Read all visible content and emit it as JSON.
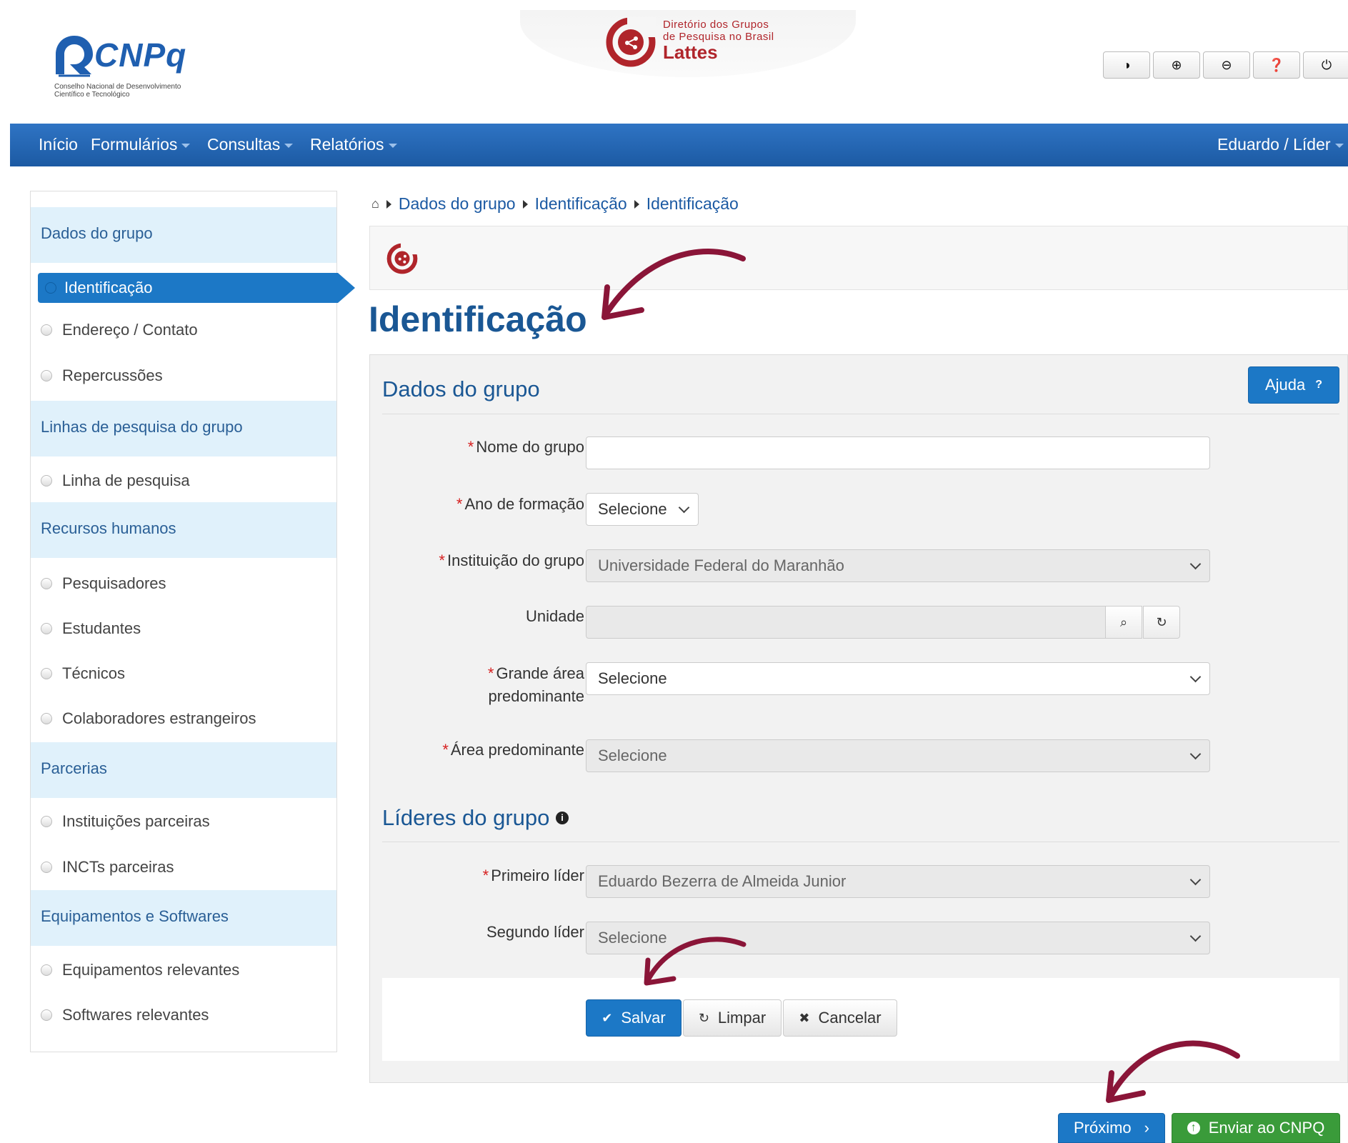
{
  "header": {
    "cnpq_logo_text": "CNPq",
    "cnpq_subtitle": "Conselho Nacional de Desenvolvimento Científico e Tecnológico",
    "lattes_title_line1": "Diretório dos Grupos",
    "lattes_title_line2": "de Pesquisa no Brasil",
    "lattes_word": "Lattes",
    "accessibility_icons": [
      "contrast-icon",
      "zoom-in-icon",
      "zoom-out-icon",
      "help-icon",
      "power-icon"
    ]
  },
  "navbar": {
    "items": [
      "Início",
      "Formulários",
      "Consultas",
      "Relatórios"
    ],
    "user": "Eduardo / Líder"
  },
  "sidebar": {
    "sections": [
      {
        "title": "Dados do grupo",
        "items": [
          "Identificação",
          "Endereço / Contato",
          "Repercussões"
        ]
      },
      {
        "title": "Linhas de pesquisa do grupo",
        "items": [
          "Linha de pesquisa"
        ]
      },
      {
        "title": "Recursos humanos",
        "items": [
          "Pesquisadores",
          "Estudantes",
          "Técnicos",
          "Colaboradores estrangeiros"
        ]
      },
      {
        "title": "Parcerias",
        "items": [
          "Instituições parceiras",
          "INCTs parceiras"
        ]
      },
      {
        "title": "Equipamentos e Softwares",
        "items": [
          "Equipamentos relevantes",
          "Softwares relevantes"
        ]
      }
    ],
    "active_item": "Identificação"
  },
  "breadcrumb": [
    "Dados do grupo",
    "Identificação",
    "Identificação"
  ],
  "page_title": "Identificação",
  "form": {
    "section1_title": "Dados do grupo",
    "help_label": "Ajuda",
    "help_glyph": "?",
    "required_mark": "*",
    "fields": {
      "nome": {
        "label": "Nome do grupo",
        "value": ""
      },
      "ano": {
        "label": "Ano de formação",
        "value": "Selecione"
      },
      "instituicao": {
        "label": "Instituição do grupo",
        "value": "Universidade Federal do Maranhão"
      },
      "unidade": {
        "label": "Unidade",
        "value": ""
      },
      "grande_area": {
        "label_line1": "Grande área",
        "label_line2": "predominante",
        "value": "Selecione"
      },
      "area": {
        "label": "Área predominante",
        "value": "Selecione"
      }
    },
    "section2_title": "Líderes do grupo",
    "leaders": {
      "primeiro": {
        "label": "Primeiro líder",
        "value": "Eduardo Bezerra de Almeida Junior"
      },
      "segundo": {
        "label": "Segundo líder",
        "value": "Selecione"
      }
    },
    "buttons": {
      "save": "Salvar",
      "clear": "Limpar",
      "cancel": "Cancelar"
    }
  },
  "footer_buttons": {
    "next": "Próximo",
    "next_glyph": "›",
    "send": "Enviar ao CNPQ"
  },
  "colors": {
    "primary": "#1c78c6",
    "nav": "#1c5aa3",
    "success": "#3a9b3a",
    "annotation_arrow": "#8a1538",
    "lattes_red": "#b0252b"
  }
}
